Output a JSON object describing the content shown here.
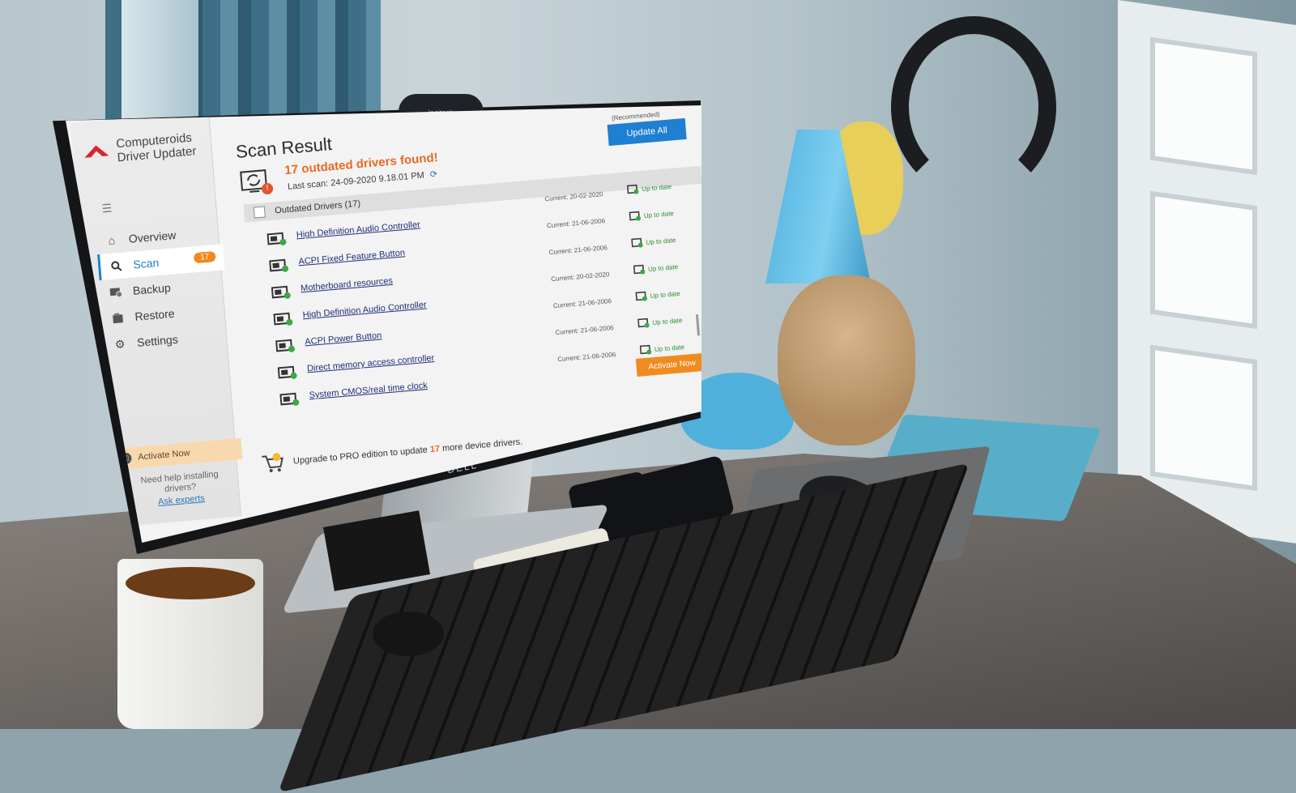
{
  "app": {
    "brand_line1": "Computeroids",
    "brand_line2": "Driver Updater",
    "window_controls": [
      "=",
      "–",
      "×"
    ]
  },
  "sidebar": {
    "items": [
      {
        "label": "Overview",
        "icon": "home-icon"
      },
      {
        "label": "Scan",
        "icon": "search-icon",
        "badge": "17",
        "active": true
      },
      {
        "label": "Backup",
        "icon": "backup-icon"
      },
      {
        "label": "Restore",
        "icon": "restore-icon"
      },
      {
        "label": "Settings",
        "icon": "gear-icon"
      }
    ],
    "activate_label": "Activate Now",
    "help_text": "Need help installing drivers?",
    "help_link": "Ask experts"
  },
  "main": {
    "title": "Scan Result",
    "found_text": "17 outdated drivers found!",
    "last_scan": "Last scan: 24-09-2020 9.18.01 PM",
    "recommended": "(Recommended)",
    "update_all": "Update All",
    "list_header": "Outdated Drivers (17)",
    "rows": [
      {
        "name": "High Definition Audio Controller",
        "current": "Current: 20-02-2020",
        "status": "Up to date"
      },
      {
        "name": "ACPI Fixed Feature Button",
        "current": "Current: 21-06-2006",
        "status": "Up to date"
      },
      {
        "name": "Motherboard resources",
        "current": "Current: 21-06-2006",
        "status": "Up to date"
      },
      {
        "name": "High Definition Audio Controller",
        "current": "Current: 20-02-2020",
        "status": "Up to date"
      },
      {
        "name": "ACPI Power Button",
        "current": "Current: 21-06-2006",
        "status": "Up to date"
      },
      {
        "name": "Direct memory access controller",
        "current": "Current: 21-06-2006",
        "status": "Up to date"
      },
      {
        "name": "System CMOS/real time clock",
        "current": "Current: 21-06-2006",
        "status": "Up to date"
      }
    ],
    "activate_now": "Activate Now",
    "upgrade_pre": "Upgrade to PRO edition to update",
    "upgrade_num": "17",
    "upgrade_post": "more device drivers."
  },
  "scene": {
    "webcam_brand": "logitech",
    "monitor_brand": "DELL"
  },
  "colors": {
    "accent_blue": "#1f7fd0",
    "accent_orange": "#f08b1f",
    "alert_orange": "#ea6a22",
    "ok_green": "#2f8d2f"
  }
}
